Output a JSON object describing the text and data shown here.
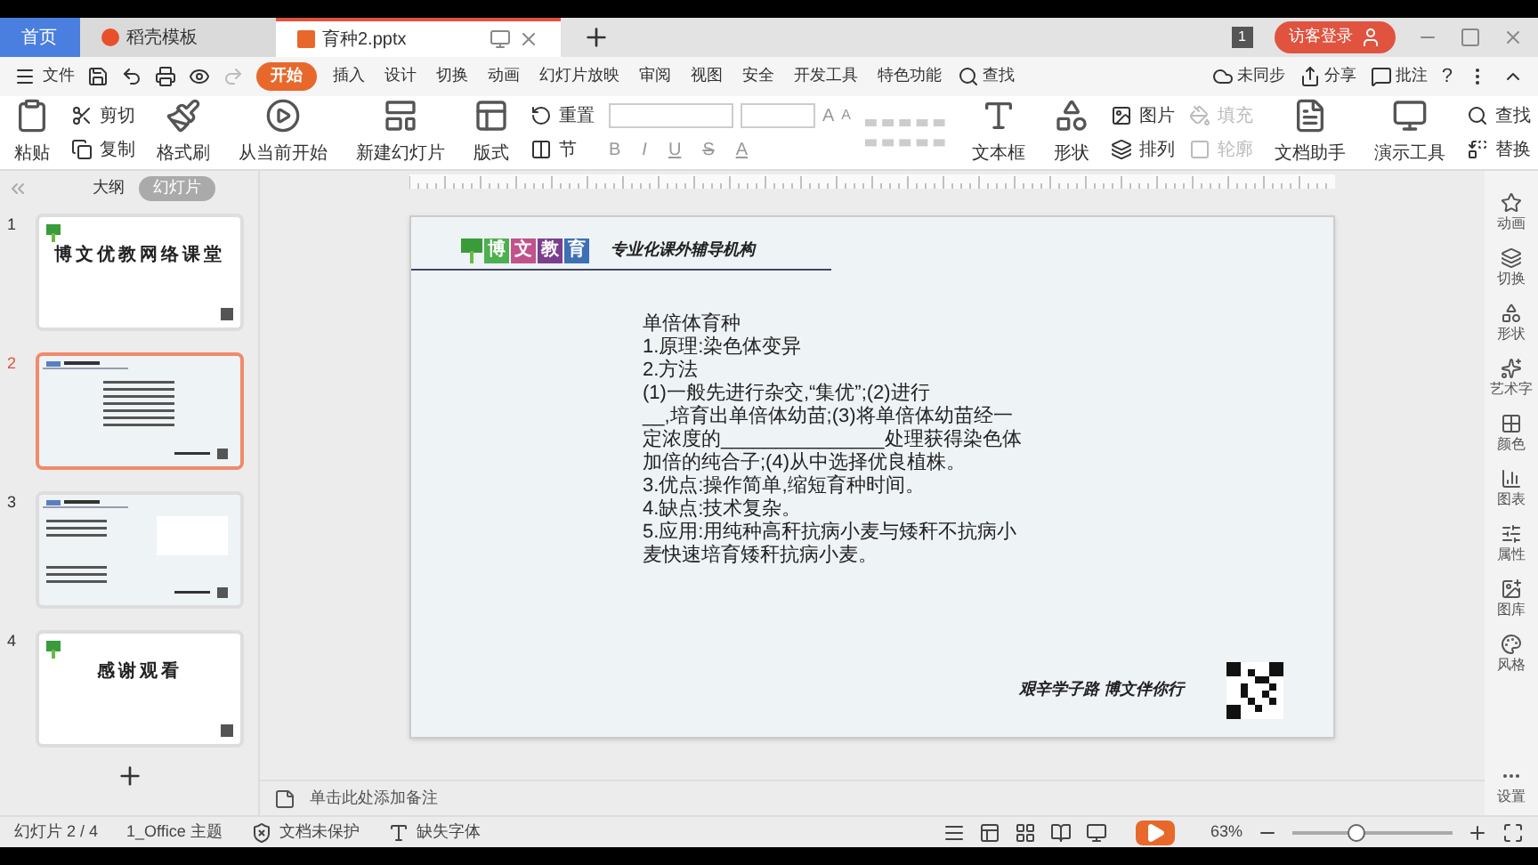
{
  "tabs": [
    {
      "label": "首页",
      "kind": "home",
      "selected": false
    },
    {
      "label": "稻壳模板",
      "kind": "template",
      "selected": false
    },
    {
      "label": "育种2.pptx",
      "kind": "document",
      "selected": true
    }
  ],
  "title_bar": {
    "badge": "1",
    "login": "访客登录"
  },
  "menu": {
    "file": "文件",
    "items": [
      {
        "label": "开始",
        "selected": true
      },
      {
        "label": "插入",
        "selected": false
      },
      {
        "label": "设计",
        "selected": false
      },
      {
        "label": "切换",
        "selected": false
      },
      {
        "label": "动画",
        "selected": false
      },
      {
        "label": "幻灯片放映",
        "selected": false
      },
      {
        "label": "审阅",
        "selected": false
      },
      {
        "label": "视图",
        "selected": false
      },
      {
        "label": "安全",
        "selected": false
      },
      {
        "label": "开发工具",
        "selected": false
      },
      {
        "label": "特色功能",
        "selected": false
      }
    ],
    "search": "查找",
    "sync": "未同步",
    "share": "分享",
    "comment": "批注",
    "help": "?"
  },
  "ribbon": {
    "paste": "粘贴",
    "cut": "剪切",
    "copy": "复制",
    "format_painter": "格式刷",
    "play_current": "从当前开始",
    "new_slide": "新建幻灯片",
    "layout": "版式",
    "reset": "重置",
    "section": "节",
    "grow": "A",
    "shrink": "A",
    "bold": "B",
    "italic": "I",
    "underline": "U",
    "strike": "S",
    "font_color_letter": "A",
    "textbox": "文本框",
    "shape": "形状",
    "picture": "图片",
    "fill": {
      "label": "填充",
      "disabled": true
    },
    "arrange": "排列",
    "outline": {
      "label": "轮廓",
      "disabled": true
    },
    "doc_helper": "文档助手",
    "present_tools": "演示工具",
    "find": "查找",
    "replace": "替换"
  },
  "panel": {
    "tabs": [
      {
        "label": "大纲",
        "selected": false
      },
      {
        "label": "幻灯片",
        "selected": true
      }
    ]
  },
  "thumbnails": [
    {
      "number": "1",
      "kind": "title",
      "title": "博文优教网络课堂",
      "selected": false
    },
    {
      "number": "2",
      "kind": "text",
      "selected": true
    },
    {
      "number": "3",
      "kind": "diagram",
      "selected": false
    },
    {
      "number": "4",
      "kind": "title",
      "title": "感谢观看",
      "selected": false
    }
  ],
  "slide": {
    "logo": [
      "博",
      "文",
      "教",
      "育"
    ],
    "slogan": "专业化课外辅导机构",
    "lines": [
      "单倍体育种",
      "1.原理:染色体变异",
      "2.方法",
      "(1)一般先进行杂交,“集优”;(2)进行",
      "__,培育出单倍体幼苗;(3)将单倍体幼苗经一",
      "定浓度的_______________处理获得染色体",
      "加倍的纯合子;(4)从中选择优良植株。",
      "3.优点:操作简单,缩短育种时间。",
      "4.缺点:技术复杂。",
      "5.应用:用纯种高秆抗病小麦与矮秆不抗病小",
      "麦快速培育矮秆抗病小麦。"
    ],
    "footer": "艰辛学子路 博文伴你行"
  },
  "notes_placeholder": "单击此处添加备注",
  "sidebar": [
    "动画",
    "切换",
    "形状",
    "艺术字",
    "颜色",
    "图表",
    "属性",
    "图库",
    "风格",
    "设置"
  ],
  "status_bar": {
    "slide": "幻灯片 2 / 4",
    "theme": "1_Office 主题",
    "protect": "文档未保护",
    "fonts": "缺失字体",
    "zoom": "63%",
    "zoom_slider": {
      "level": 0.4
    }
  }
}
